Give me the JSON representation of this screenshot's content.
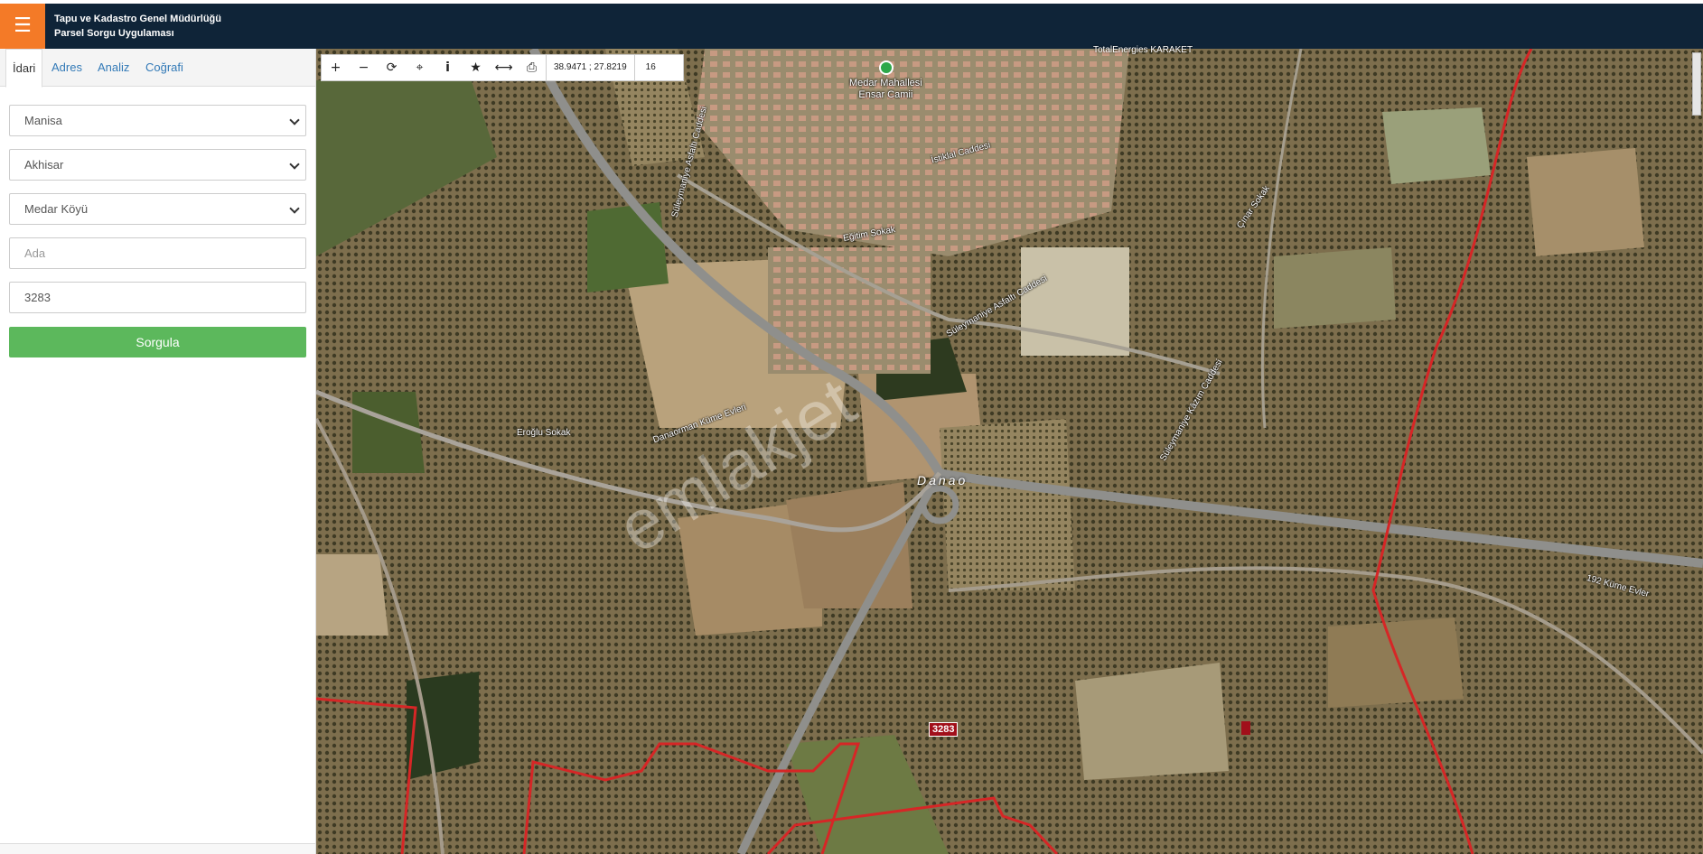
{
  "header": {
    "menu_icon": "☰",
    "title_line1": "Tapu ve Kadastro Genel Müdürlüğü",
    "title_line2": "Parsel Sorgu Uygulaması",
    "bar_color": "#0f2438",
    "menu_color": "#f47a27"
  },
  "sidebar": {
    "tabs": [
      {
        "label": "İdari",
        "active": true
      },
      {
        "label": "Adres"
      },
      {
        "label": "Analiz"
      },
      {
        "label": "Coğrafi"
      }
    ],
    "province": "Manisa",
    "district": "Akhisar",
    "neighborhood": "Medar Köyü",
    "ada_placeholder": "Ada",
    "parsel_value": "3283",
    "query_button": "Sorgula",
    "button_color": "#5cb85c"
  },
  "map_toolbar": {
    "zoom_in_icon": "+",
    "zoom_out_icon": "−",
    "refresh_icon": "⟳",
    "locate_icon": "⌖",
    "info_icon": "i",
    "favorite_icon": "★",
    "measure_icon": "⟷",
    "print_icon": "⎙",
    "coordinates": "38.9471 ; 27.8219",
    "zoom_level": "16"
  },
  "map": {
    "parcel_label": "3283",
    "place_name": "Danao",
    "poi_name_line1": "Medar Mahallesi",
    "poi_name_line2": "Ensar Camii",
    "top_label": "TotalEnergies KARAKET",
    "watermark": "emlakjet",
    "street_labels": [
      {
        "text": "Süleymaniye Kâzım Caddesi"
      },
      {
        "text": "Eğitim Sokak"
      },
      {
        "text": "Süleymaniye Asfaltı Caddesi"
      },
      {
        "text": "Danaorman Küme Evleri"
      },
      {
        "text": "Eroğlu Sokak"
      },
      {
        "text": "192 Küme Evler"
      },
      {
        "text": "İstiklal Caddesi"
      },
      {
        "text": "Çınar Sokak"
      },
      {
        "text": "Süleymaniye Asfaltı Caddesi"
      }
    ]
  }
}
